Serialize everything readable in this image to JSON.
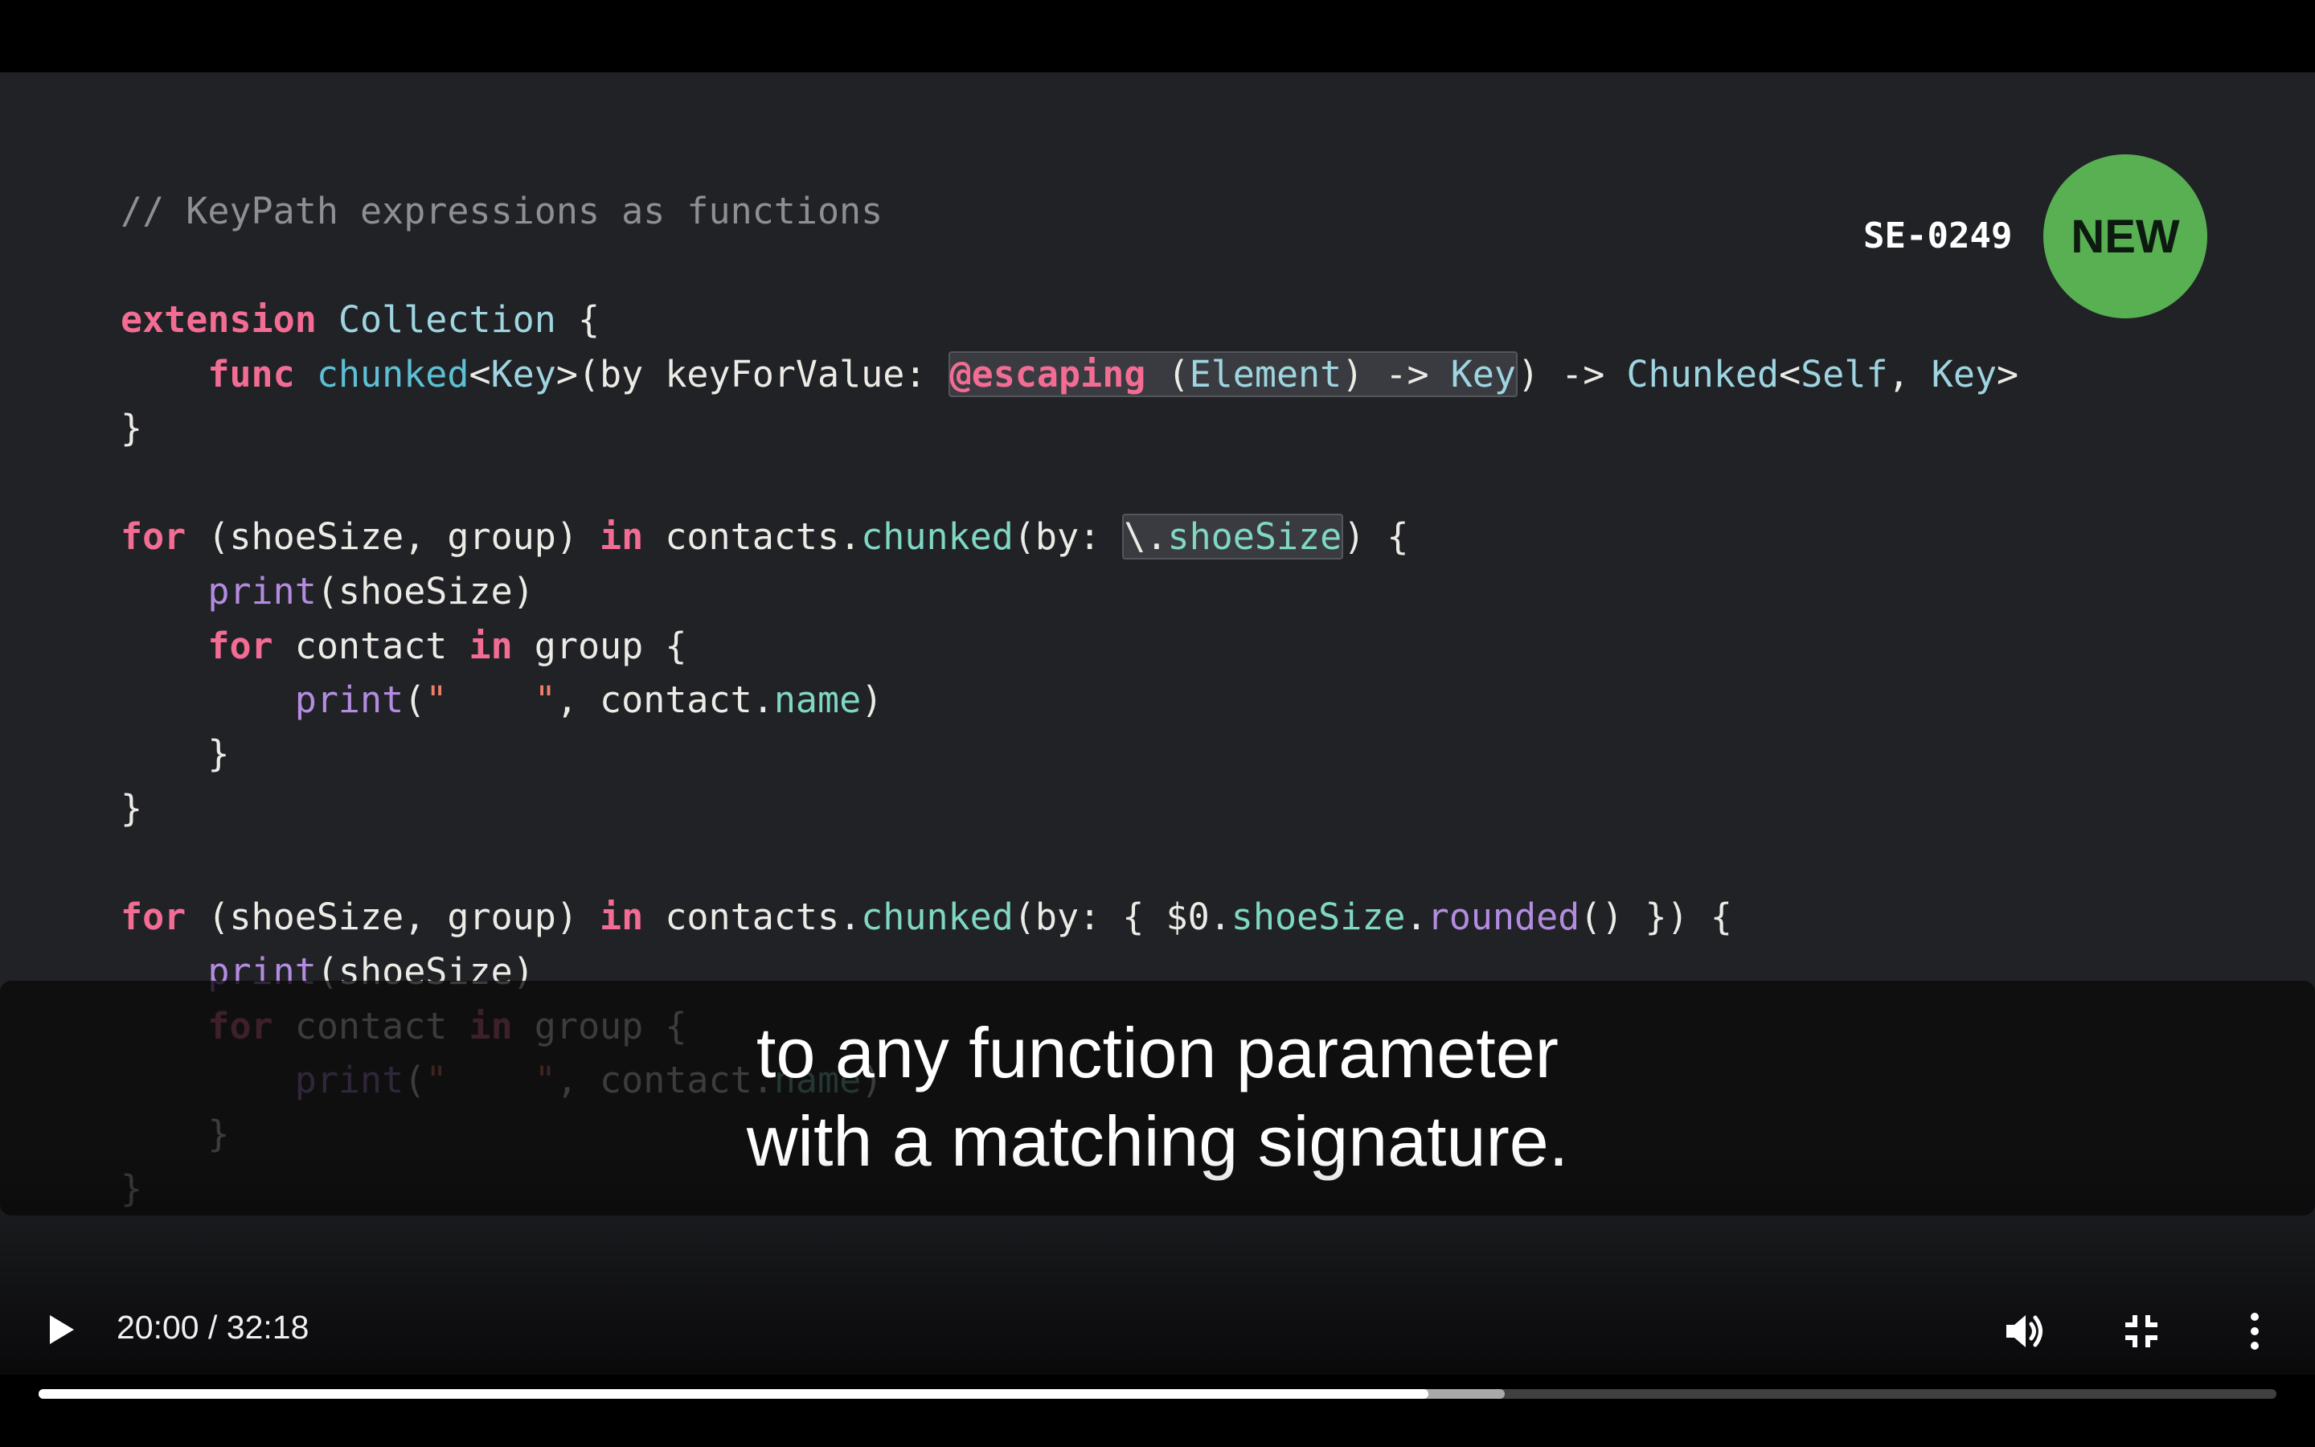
{
  "slide": {
    "se_label": "SE-0249",
    "badge": "NEW",
    "code_comment": "// KeyPath expressions as functions"
  },
  "caption": {
    "line1": "to any function parameter",
    "line2": "with a matching signature."
  },
  "player": {
    "current_time": "20:00",
    "separator": " / ",
    "duration": "32:18",
    "progress_percent": 62.1,
    "buffered_percent": 65.5
  },
  "icons": {
    "play": "play-icon",
    "volume": "volume-icon",
    "exit_fullscreen": "exit-fullscreen-icon",
    "more": "more-vertical-icon"
  }
}
